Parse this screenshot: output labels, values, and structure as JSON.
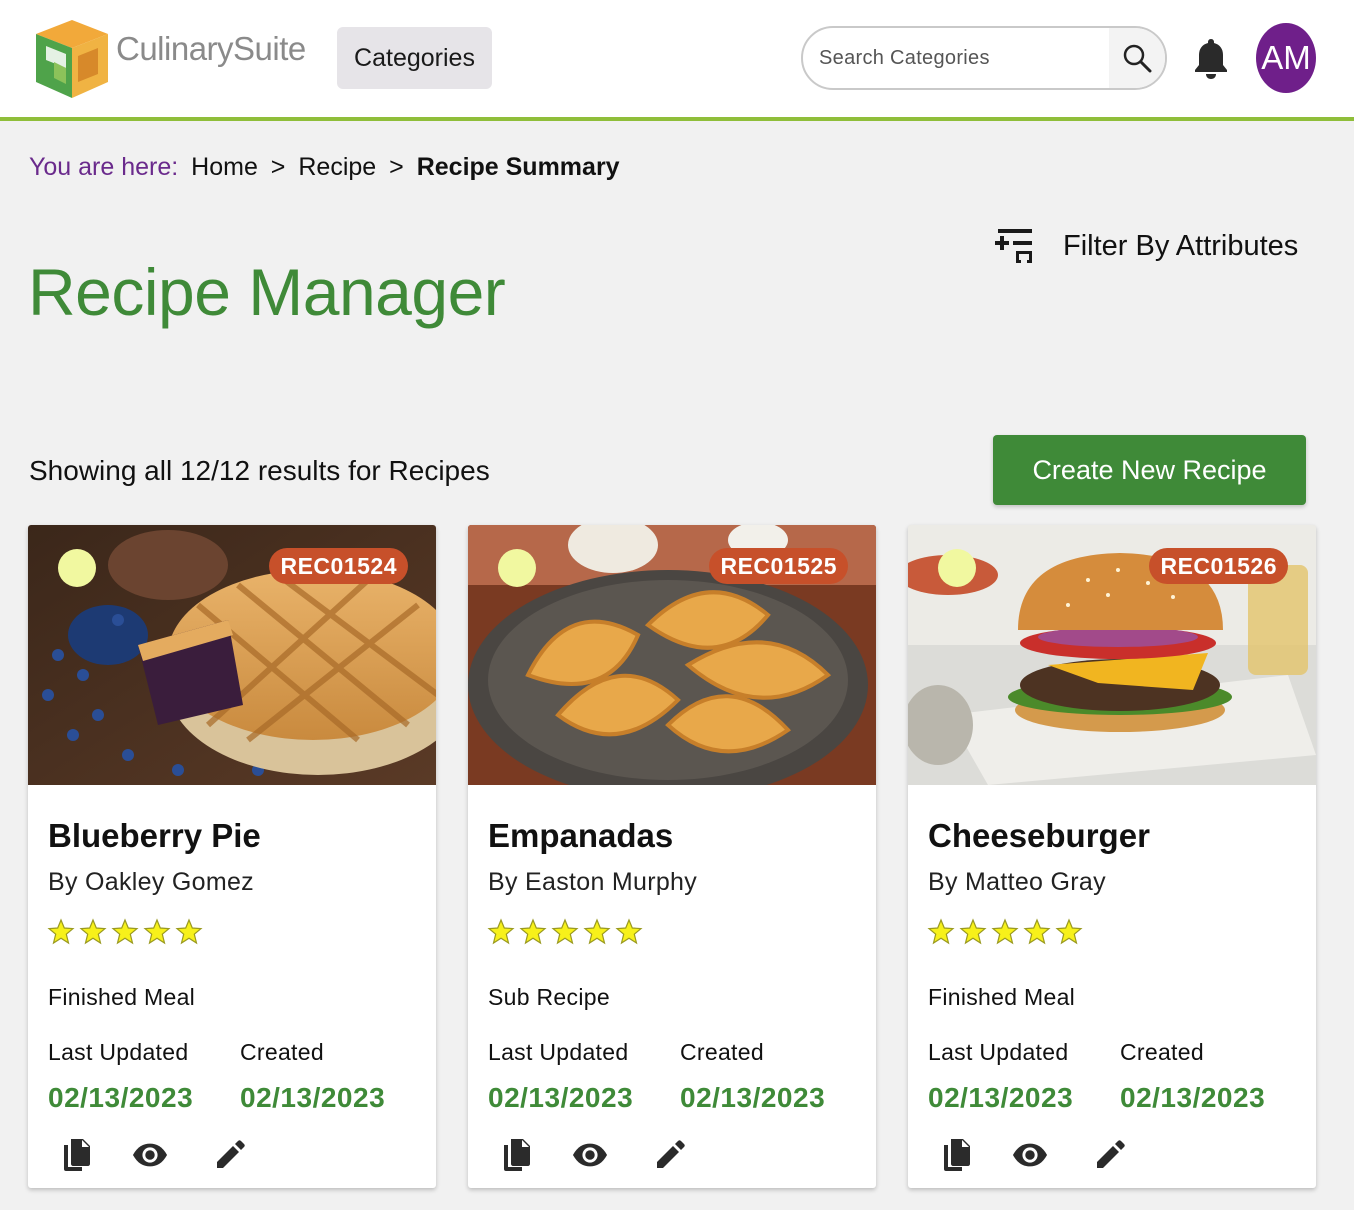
{
  "header": {
    "brand": "CulinarySuite",
    "categories_label": "Categories",
    "search_placeholder": "Search Categories",
    "avatar_initials": "AM",
    "accent_color": "#8fbe3a"
  },
  "breadcrumb": {
    "prefix": "You are here:",
    "items": [
      "Home",
      "Recipe",
      "Recipe Summary"
    ],
    "separator": ">"
  },
  "filter": {
    "label": "Filter By Attributes"
  },
  "page": {
    "title": "Recipe Manager",
    "result_count": "Showing all 12/12 results for Recipes",
    "create_label": "Create New Recipe",
    "primary_color": "#3f8a38"
  },
  "labels": {
    "last_updated": "Last Updated",
    "created": "Created"
  },
  "recipes": [
    {
      "id": "REC01524",
      "title": "Blueberry Pie",
      "author": "By Oakley Gomez",
      "rating": 5,
      "type": "Finished Meal",
      "last_updated": "02/13/2023",
      "created": "02/13/2023"
    },
    {
      "id": "REC01525",
      "title": "Empanadas",
      "author": "By Easton Murphy",
      "rating": 5,
      "type": "Sub Recipe",
      "last_updated": "02/13/2023",
      "created": "02/13/2023"
    },
    {
      "id": "REC01526",
      "title": "Cheeseburger",
      "author": "By Matteo Gray",
      "rating": 5,
      "type": "Finished Meal",
      "last_updated": "02/13/2023",
      "created": "02/13/2023"
    }
  ]
}
